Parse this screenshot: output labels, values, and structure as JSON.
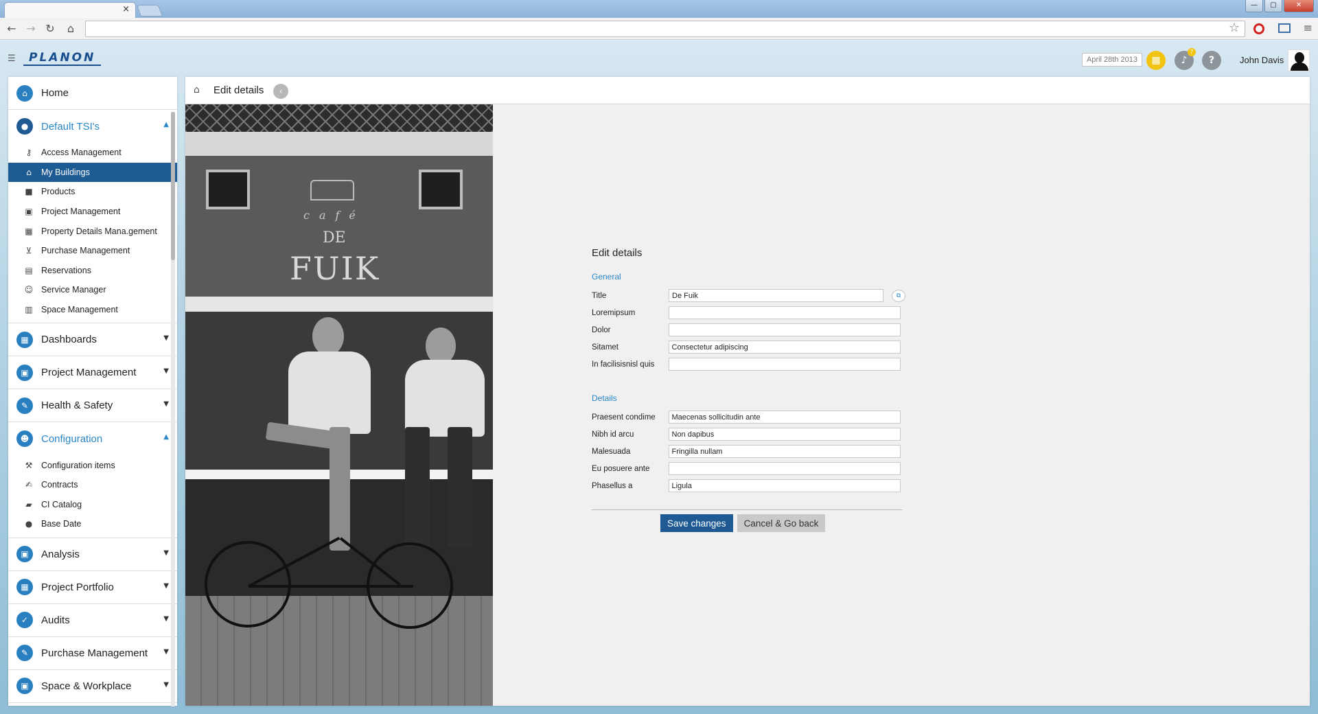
{
  "browser": {
    "tab_close": "×",
    "address": "",
    "window_buttons": {
      "minimize": "—",
      "maximize": "▢",
      "close": "✕"
    }
  },
  "header": {
    "logo": "PLANON",
    "date": "April 28th 2013",
    "notification_count": "7",
    "help": "?",
    "user_name": "John Davis"
  },
  "sidebar": {
    "home": "Home",
    "default_tsis": {
      "label": "Default TSI's",
      "items": [
        {
          "label": "Access Management",
          "icon": "key-icon"
        },
        {
          "label": "My Buildings",
          "icon": "building-user-icon",
          "active": true
        },
        {
          "label": "Products",
          "icon": "box-icon"
        },
        {
          "label": "Project Management",
          "icon": "briefcase-icon"
        },
        {
          "label": "Property Details Mana.gement",
          "icon": "grid-building-icon"
        },
        {
          "label": "Purchase Management",
          "icon": "cart-icon"
        },
        {
          "label": "Reservations",
          "icon": "reservation-icon"
        },
        {
          "label": "Service Manager",
          "icon": "service-icon"
        },
        {
          "label": "Space Management",
          "icon": "floorplan-icon"
        }
      ]
    },
    "dashboards": "Dashboards",
    "project_management": "Project Management",
    "health_safety": "Health & Safety",
    "configuration": {
      "label": "Configuration",
      "items": [
        {
          "label": "Configuration items",
          "icon": "wrench-icon"
        },
        {
          "label": "Contracts",
          "icon": "contract-icon"
        },
        {
          "label": "CI Catalog",
          "icon": "catalog-icon"
        },
        {
          "label": "Base Date",
          "icon": "drop-icon"
        }
      ]
    },
    "analysis": "Analysis",
    "project_portfolio": "Project Portfolio",
    "audits": "Audits",
    "purchase_management": "Purchase Management",
    "space_workplace": "Space & Workplace"
  },
  "main": {
    "header_title": "Edit details",
    "photo": {
      "cafe": "café",
      "de": "DE",
      "fuik": "FUIK"
    },
    "form": {
      "title": "Edit details",
      "general": {
        "title": "General",
        "fields": [
          {
            "label": "Title",
            "value": "De Fuik"
          },
          {
            "label": "Loremipsum",
            "value": ""
          },
          {
            "label": "Dolor",
            "value": ""
          },
          {
            "label": "Sitamet",
            "value": "Consectetur adipiscing"
          },
          {
            "label": "In facilisisnisl quis",
            "value": ""
          }
        ]
      },
      "details": {
        "title": "Details",
        "fields": [
          {
            "label": "Praesent condime",
            "value": "Maecenas sollicitudin ante"
          },
          {
            "label": "Nibh id arcu",
            "value": "Non dapibus"
          },
          {
            "label": "Malesuada",
            "value": "Fringilla nullam"
          },
          {
            "label": "Eu posuere ante",
            "value": ""
          },
          {
            "label": "Phasellus a",
            "value": "Ligula"
          }
        ]
      },
      "save_label": "Save changes",
      "cancel_label": "Cancel & Go back"
    }
  },
  "colors": {
    "accent": "#2a87c8",
    "active_nav": "#1e5a94",
    "save_button": "#1f5a94",
    "calendar": "#f1c40f"
  }
}
